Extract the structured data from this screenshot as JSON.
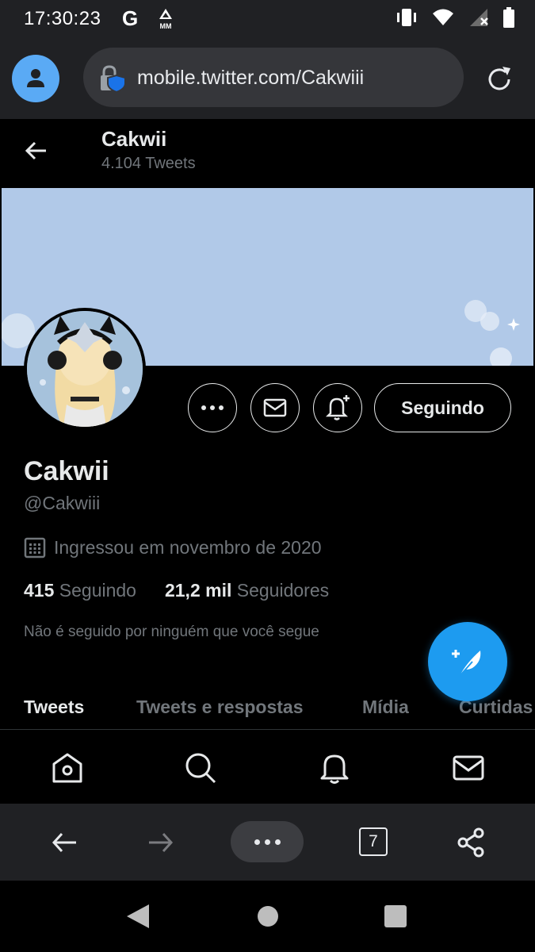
{
  "status_bar": {
    "time": "17:30:23",
    "g_letter": "G",
    "mm_label": "MM",
    "icons": [
      "vibrate-icon",
      "wifi-icon",
      "signal-icon",
      "battery-icon"
    ]
  },
  "browser": {
    "url": "mobile.twitter.com/Cakwiii",
    "tab_count": "7",
    "accent": "#5aaaf5"
  },
  "header": {
    "title": "Cakwii",
    "tweet_count": "4.104 Tweets"
  },
  "profile": {
    "name": "Cakwii",
    "handle": "@Cakwiii",
    "joined": "Ingressou em novembro de 2020",
    "following_count": "415",
    "following_label": "Seguindo",
    "followers_count": "21,2 mil",
    "followers_label": "Seguidores",
    "note": "Não é seguido por ninguém que você segue",
    "follow_button": "Seguindo",
    "banner_color": "#b1c9e8"
  },
  "tabs": [
    {
      "label": "Tweets",
      "active": true
    },
    {
      "label": "Tweets e respostas",
      "active": false
    },
    {
      "label": "Mídia",
      "active": false
    },
    {
      "label": "Curtidas",
      "active": false
    }
  ],
  "nav": [
    "home-icon",
    "search-icon",
    "notifications-icon",
    "messages-icon"
  ],
  "colors": {
    "twitter_blue": "#1d9bf0",
    "muted_text": "#71767b"
  }
}
